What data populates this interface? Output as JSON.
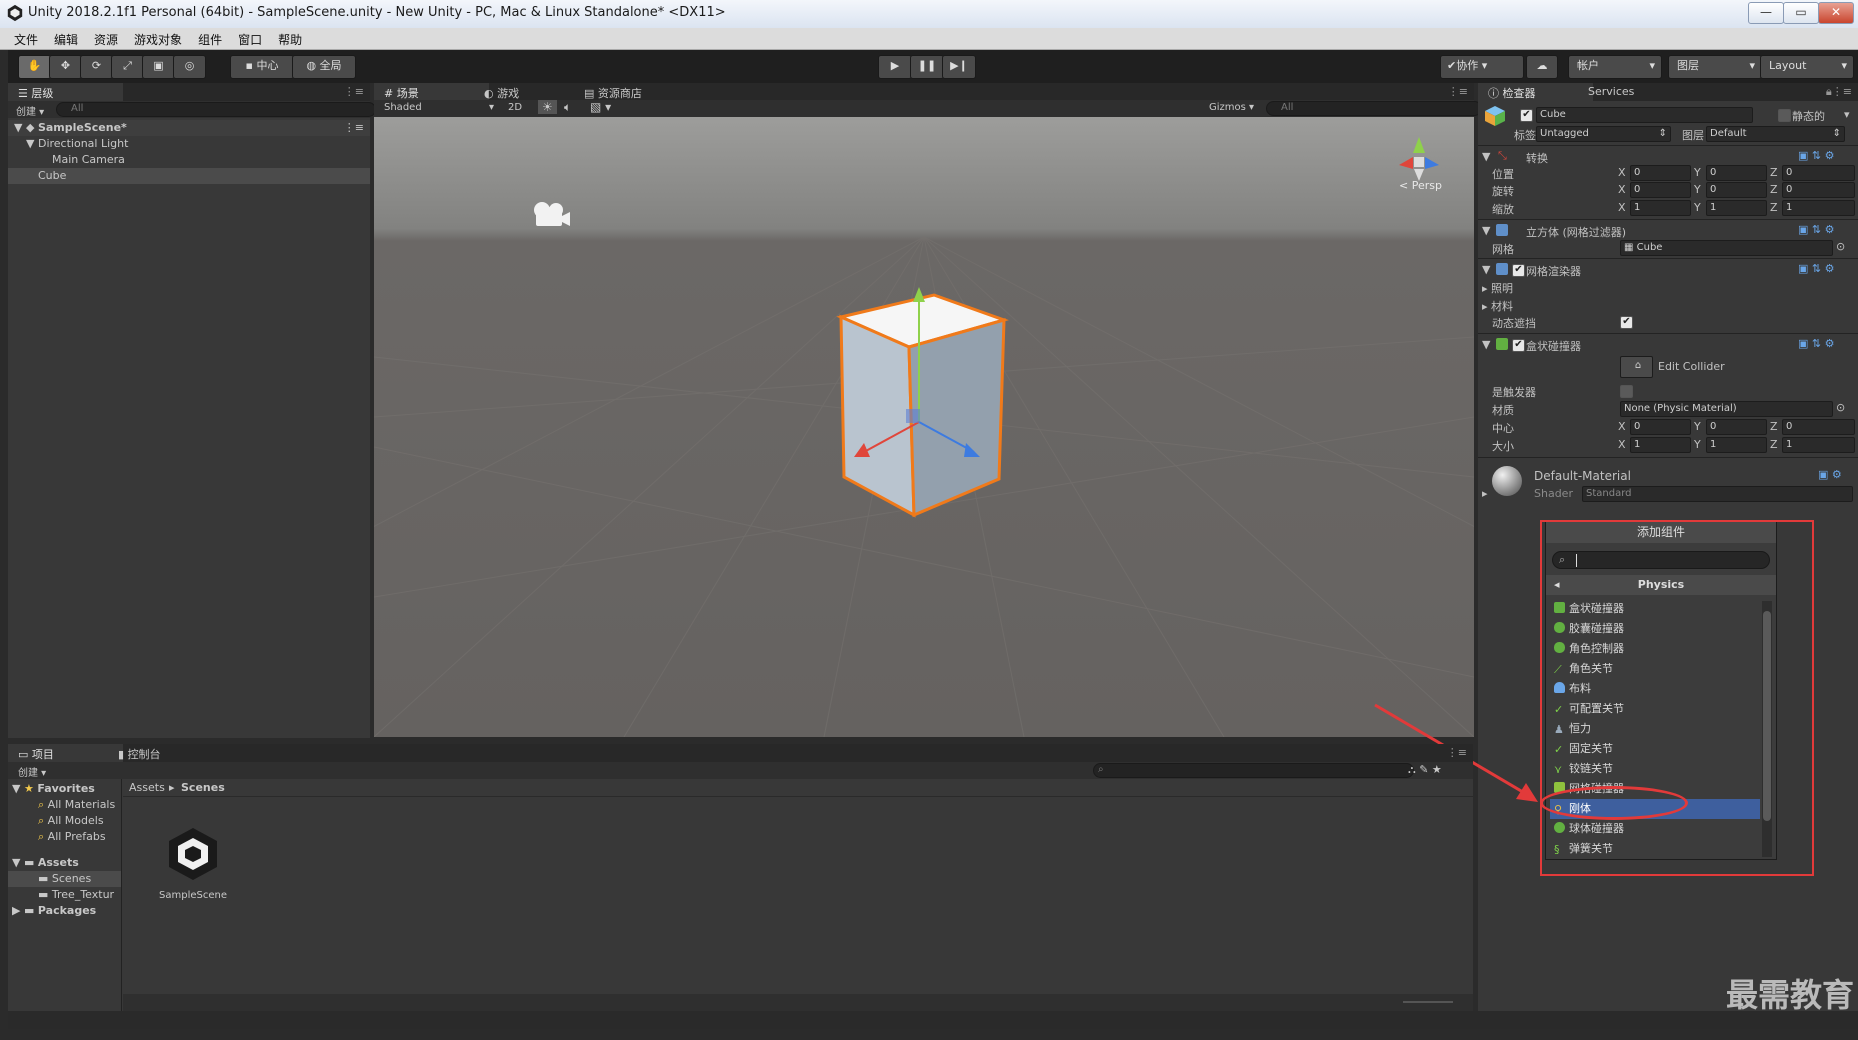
{
  "window": {
    "title": "Unity 2018.2.1f1 Personal (64bit) - SampleScene.unity - New Unity - PC, Mac & Linux Standalone* <DX11>"
  },
  "menu": [
    "文件",
    "编辑",
    "资源",
    "游戏对象",
    "组件",
    "窗口",
    "帮助"
  ],
  "toolbar": {
    "pivot": "中心",
    "global": "全局",
    "collab": "协作",
    "account": "帐户",
    "layers": "图层",
    "layout": "Layout"
  },
  "hierarchy": {
    "tab": "层级",
    "create": "创建",
    "search_placeholder": "All",
    "scene": "SampleScene*",
    "items": [
      "Directional Light",
      "Main Camera",
      "Cube"
    ]
  },
  "scene_view": {
    "tabs": [
      "场景",
      "游戏",
      "资源商店"
    ],
    "shading": "Shaded",
    "mode_2d": "2D",
    "gizmos": "Gizmos",
    "search_placeholder": "All",
    "persp": "Persp"
  },
  "inspector": {
    "tabs": [
      "检查器",
      "Services"
    ],
    "object_name": "Cube",
    "static_label": "静态的",
    "tag_label": "标签",
    "tag_value": "Untagged",
    "layer_label": "图层",
    "layer_value": "Default",
    "transform": {
      "header": "转换",
      "position_label": "位置",
      "rotation_label": "旋转",
      "scale_label": "缩放",
      "position": [
        "0",
        "0",
        "0"
      ],
      "rotation": [
        "0",
        "0",
        "0"
      ],
      "scale": [
        "1",
        "1",
        "1"
      ]
    },
    "mesh_filter": {
      "header": "立方体 (网格过滤器)",
      "mesh_label": "网格",
      "mesh_value": "Cube"
    },
    "mesh_renderer": {
      "header": "网格渲染器",
      "lighting": "照明",
      "materials": "材料",
      "dynamic_occlusion": "动态遮挡"
    },
    "box_collider": {
      "header": "盒状碰撞器",
      "edit_collider": "Edit Collider",
      "is_trigger": "是触发器",
      "material_label": "材质",
      "material_value": "None (Physic Material)",
      "center_label": "中心",
      "size_label": "大小",
      "center": [
        "0",
        "0",
        "0"
      ],
      "size": [
        "1",
        "1",
        "1"
      ]
    },
    "material": {
      "name": "Default-Material",
      "shader_label": "Shader",
      "shader_value": "Standard"
    },
    "axis": [
      "X",
      "Y",
      "Z"
    ]
  },
  "add_component": {
    "title": "添加组件",
    "search_value": "",
    "category": "Physics",
    "items": [
      "盒状碰撞器",
      "胶囊碰撞器",
      "角色控制器",
      "角色关节",
      "布料",
      "可配置关节",
      "恒力",
      "固定关节",
      "铰链关节",
      "网格碰撞器",
      "刚体",
      "球体碰撞器",
      "弹簧关节"
    ],
    "selected": "刚体",
    "colors": {
      "highlight": "#e23a3a",
      "selected_row": "#3e5f9e"
    }
  },
  "project": {
    "tabs": [
      "项目",
      "控制台"
    ],
    "create": "创建",
    "favorites": "Favorites",
    "favorite_items": [
      "All Materials",
      "All Models",
      "All Prefabs"
    ],
    "assets": "Assets",
    "asset_folders": [
      "Scenes",
      "Tree_Textur"
    ],
    "packages": "Packages",
    "breadcrumb": [
      "Assets",
      "Scenes"
    ],
    "asset_name": "SampleScene"
  },
  "watermark": "最需教育"
}
